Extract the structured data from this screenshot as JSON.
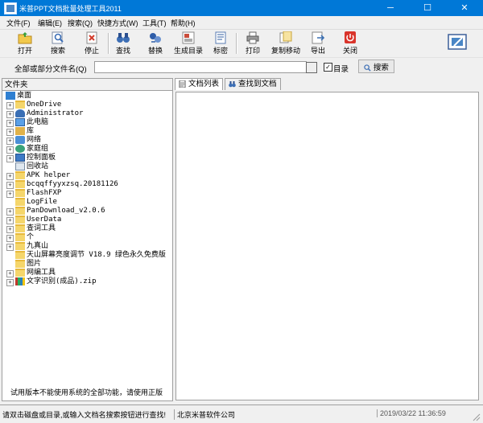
{
  "window": {
    "title": "米普PPT文档批量处理工具2011",
    "minimize": "─",
    "maximize": "☐",
    "close": "✕"
  },
  "menu": [
    "文件(F)",
    "编辑(E)",
    "搜索(Q)",
    "快捷方式(W)",
    "工具(T)",
    "帮助(H)"
  ],
  "toolbar": {
    "buttons": [
      {
        "label": "打开",
        "icon": "open-folder-icon",
        "color": "#d9a71f"
      },
      {
        "label": "搜索",
        "icon": "search-icon",
        "color": "#4a7fc0"
      },
      {
        "label": "停止",
        "icon": "stop-icon",
        "color": "#d23b2a"
      },
      {
        "label": "查找",
        "icon": "binoculars-icon",
        "color": "#3c6eb5"
      },
      {
        "label": "替换",
        "icon": "replace-icon",
        "color": "#2f5da8"
      },
      {
        "label": "生成目录",
        "icon": "generate-toc-icon",
        "color": "#c94d3b"
      },
      {
        "label": "标密",
        "icon": "mark-secret-icon",
        "color": "#5a7db3"
      },
      {
        "label": "打印",
        "icon": "printer-icon",
        "color": "#6d6d6d"
      },
      {
        "label": "复制移动",
        "icon": "copy-move-icon",
        "color": "#c9a43a"
      },
      {
        "label": "导出",
        "icon": "export-icon",
        "color": "#3b6fb0"
      },
      {
        "label": "关闭",
        "icon": "power-icon",
        "color": "#d9342b"
      }
    ]
  },
  "search": {
    "label": "全部或部分文件名(Q)",
    "value": "",
    "checkbox_label": "目录",
    "checkbox_checked": true,
    "checkbox_mark": "✓",
    "button_label": "搜索"
  },
  "left_panel": {
    "header": "文件夹",
    "tree": [
      {
        "label": "桌面",
        "icon": "desktop-icon",
        "expander": "",
        "indent": 0
      },
      {
        "label": "OneDrive",
        "icon": "folder-icon",
        "expander": "+",
        "indent": 1
      },
      {
        "label": "Administrator",
        "icon": "user-icon",
        "expander": "+",
        "indent": 1
      },
      {
        "label": "此电脑",
        "icon": "computer-icon",
        "expander": "+",
        "indent": 1
      },
      {
        "label": "库",
        "icon": "library-icon",
        "expander": "+",
        "indent": 1
      },
      {
        "label": "网络",
        "icon": "network-icon",
        "expander": "+",
        "indent": 1
      },
      {
        "label": "家庭组",
        "icon": "homegroup-icon",
        "expander": "+",
        "indent": 1
      },
      {
        "label": "控制面板",
        "icon": "control-panel-icon",
        "expander": "+",
        "indent": 1
      },
      {
        "label": "回收站",
        "icon": "recycle-bin-icon",
        "expander": "",
        "indent": 1
      },
      {
        "label": "APK helper",
        "icon": "folder-icon",
        "expander": "+",
        "indent": 1
      },
      {
        "label": "bcqqffyyxzsq.20181126",
        "icon": "folder-icon",
        "expander": "+",
        "indent": 1
      },
      {
        "label": "FlashFXP",
        "icon": "folder-icon",
        "expander": "+",
        "indent": 1
      },
      {
        "label": "LogFile",
        "icon": "folder-icon",
        "expander": "",
        "indent": 1
      },
      {
        "label": "PanDownload_v2.0.6",
        "icon": "folder-icon",
        "expander": "+",
        "indent": 1
      },
      {
        "label": "UserData",
        "icon": "folder-icon",
        "expander": "+",
        "indent": 1
      },
      {
        "label": "查词工具",
        "icon": "folder-icon",
        "expander": "+",
        "indent": 1
      },
      {
        "label": "个",
        "icon": "folder-icon",
        "expander": "+",
        "indent": 1
      },
      {
        "label": "九真山",
        "icon": "folder-icon",
        "expander": "+",
        "indent": 1
      },
      {
        "label": "天山屏幕亮度调节 V18.9 绿色永久免费版",
        "icon": "folder-icon",
        "expander": "",
        "indent": 1
      },
      {
        "label": "图片",
        "icon": "folder-icon",
        "expander": "",
        "indent": 1
      },
      {
        "label": "网编工具",
        "icon": "folder-icon",
        "expander": "+",
        "indent": 1
      },
      {
        "label": "文字识别(成品).zip",
        "icon": "zip-archive-icon",
        "expander": "+",
        "indent": 1
      }
    ],
    "footer": "试用版本不能使用系统的全部功能，请使用正版"
  },
  "right_panel": {
    "tabs": [
      {
        "label": "文档列表",
        "active": true,
        "icon": "document-list-icon"
      },
      {
        "label": "查找到文档",
        "active": false,
        "icon": "binoculars-icon"
      }
    ]
  },
  "status": {
    "hint": "请双击磁盘或目录,或输入文档名搜索按钮进行查找!",
    "company": "北京米普软件公司",
    "datetime": "2019/03/22 11:36:59"
  },
  "colors": {
    "titlebar": "#0078d7",
    "panel_bg": "#f0f0f0",
    "border": "#a0a0a0"
  }
}
